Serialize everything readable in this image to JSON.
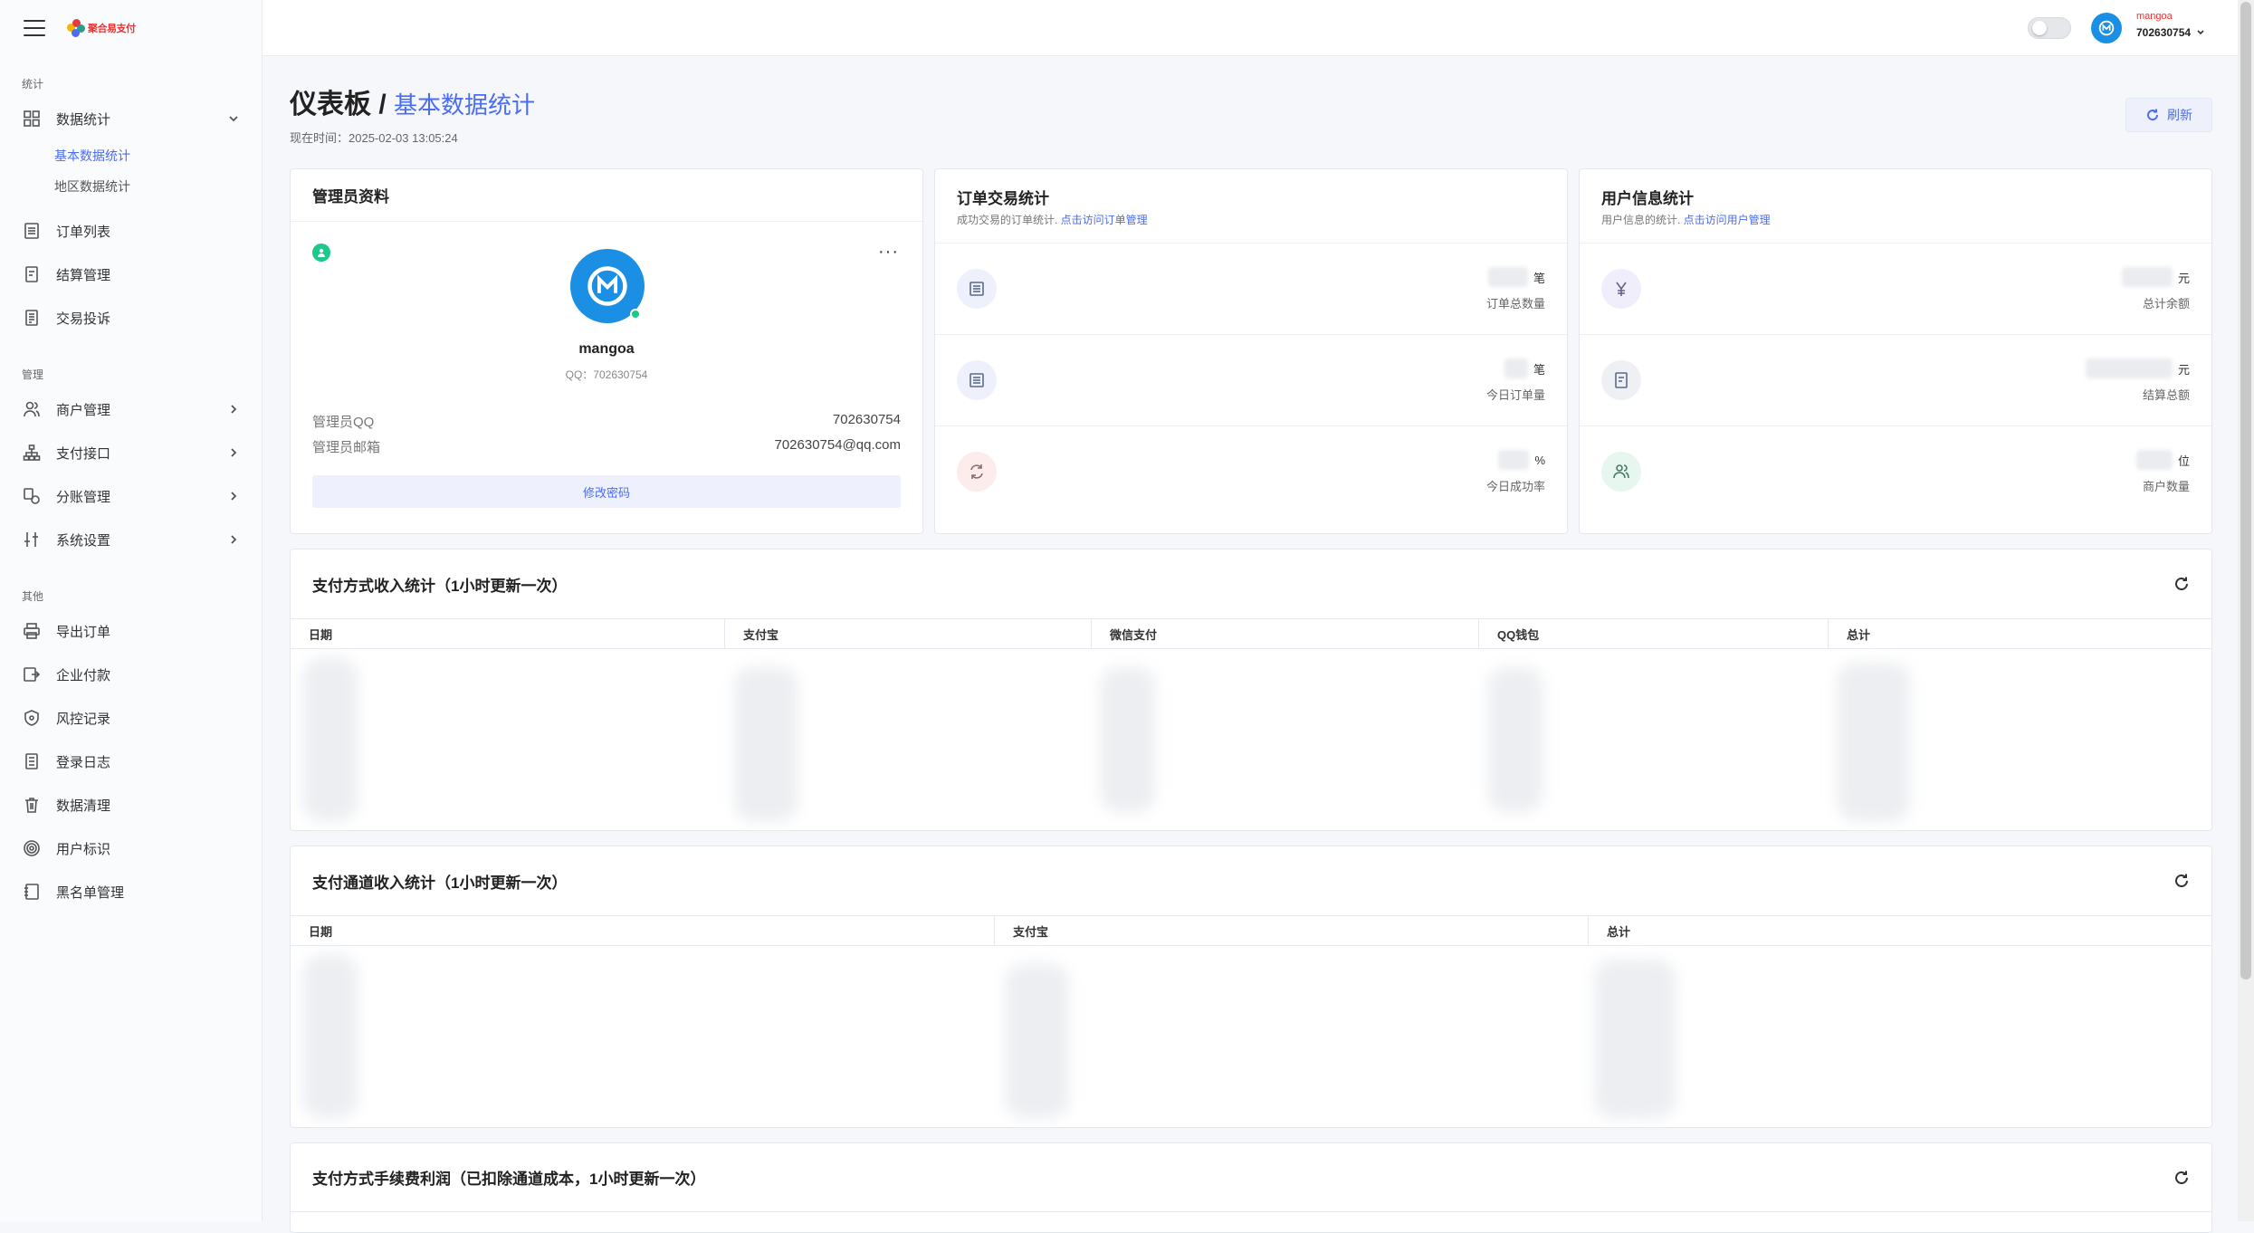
{
  "sidebar": {
    "logo_text": "聚合易支付",
    "sections": [
      {
        "title": "统计"
      },
      {
        "title": "管理"
      },
      {
        "title": "其他"
      }
    ],
    "stats": {
      "label": "数据统计",
      "sub": [
        "基本数据统计",
        "地区数据统计"
      ]
    },
    "items_stats": [
      "订单列表",
      "结算管理",
      "交易投诉"
    ],
    "items_manage": [
      "商户管理",
      "支付接口",
      "分账管理",
      "系统设置"
    ],
    "items_other": [
      "导出订单",
      "企业付款",
      "风控记录",
      "登录日志",
      "数据清理",
      "用户标识",
      "黑名单管理"
    ]
  },
  "topbar": {
    "user_name": "mangoa",
    "user_id": "702630754"
  },
  "page": {
    "title": "仪表板",
    "separator": " / ",
    "subtitle": "基本数据统计",
    "time_label": "现在时间：",
    "time_value": "2025-02-03 13:05:24",
    "refresh_label": "刷新"
  },
  "admin_card": {
    "title": "管理员资料",
    "name": "mangoa",
    "qq_line": "QQ：702630754",
    "qq_label": "管理员QQ",
    "qq_value": "702630754",
    "email_label": "管理员邮箱",
    "email_value": "702630754@qq.com",
    "button": "修改密码",
    "more": "···"
  },
  "order_card": {
    "title": "订单交易统计",
    "subtitle": "成功交易的订单统计. ",
    "link": "点击访问订单管理",
    "rows": [
      {
        "unit": "笔",
        "label": "订单总数量"
      },
      {
        "unit": "笔",
        "label": "今日订单量"
      },
      {
        "unit": "%",
        "label": "今日成功率"
      }
    ]
  },
  "user_card": {
    "title": "用户信息统计",
    "subtitle": "用户信息的统计. ",
    "link": "点击访问用户管理",
    "rows": [
      {
        "unit": "元",
        "label": "总计余额"
      },
      {
        "unit": "元",
        "label": "结算总额"
      },
      {
        "unit": "位",
        "label": "商户数量"
      }
    ]
  },
  "table1": {
    "title": "支付方式收入统计（1小时更新一次）",
    "headers": [
      "日期",
      "支付宝",
      "微信支付",
      "QQ钱包",
      "总计"
    ]
  },
  "table2": {
    "title": "支付通道收入统计（1小时更新一次）",
    "headers": [
      "日期",
      "支付宝",
      "总计"
    ]
  },
  "table3": {
    "title": "支付方式手续费利润（已扣除通道成本，1小时更新一次）"
  },
  "colors": {
    "accent": "#4a6cf7",
    "green": "#1cc88a",
    "avatar": "#1a8fe3"
  }
}
